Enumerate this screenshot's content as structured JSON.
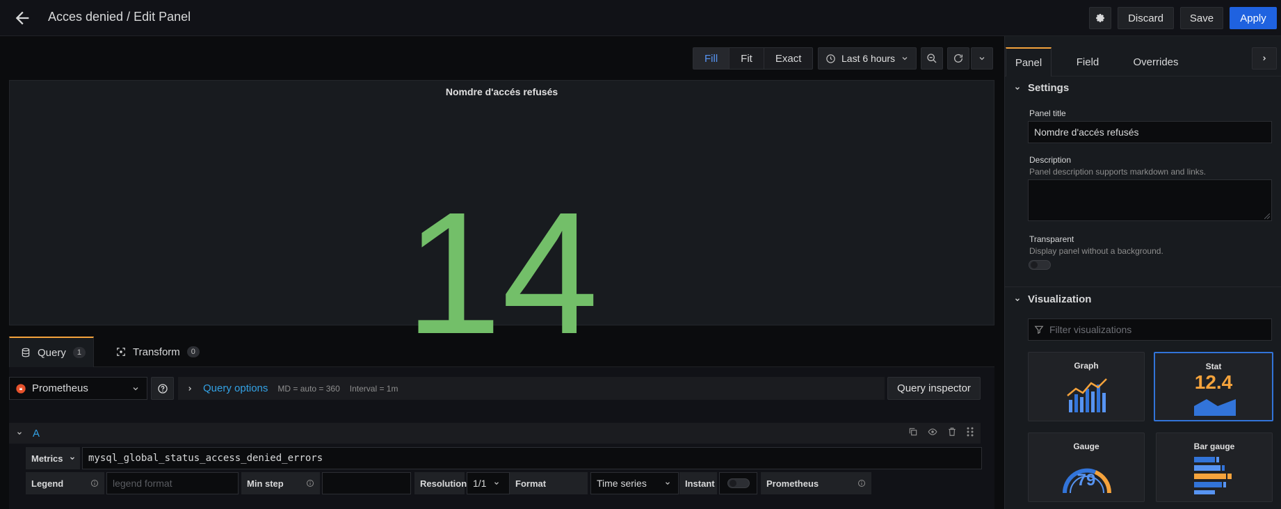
{
  "header": {
    "title": "Acces denied / Edit Panel",
    "discard_label": "Discard",
    "save_label": "Save",
    "apply_label": "Apply"
  },
  "toolbar": {
    "view_modes": [
      {
        "label": "Fill",
        "active": true
      },
      {
        "label": "Fit",
        "active": false
      },
      {
        "label": "Exact",
        "active": false
      }
    ],
    "time_range": "Last 6 hours"
  },
  "panel": {
    "title": "Nomdre d'accés refusés",
    "value": "14",
    "value_color": "#73bf69"
  },
  "query_tabs": [
    {
      "label": "Query",
      "count": "1"
    },
    {
      "label": "Transform",
      "count": "0"
    }
  ],
  "query": {
    "datasource": "Prometheus",
    "options_label": "Query options",
    "md": "MD = auto = 360",
    "interval": "Interval = 1m",
    "inspector_label": "Query inspector",
    "ref_id": "A",
    "metrics_label": "Metrics",
    "expr": "mysql_global_status_access_denied_errors",
    "legend_label": "Legend",
    "legend_placeholder": "legend format",
    "min_step_label": "Min step",
    "resolution_label": "Resolution",
    "resolution_value": "1/1",
    "format_label": "Format",
    "format_value": "Time series",
    "instant_label": "Instant",
    "instant_on": false,
    "source_label": "Prometheus"
  },
  "sidebar": {
    "tabs": [
      {
        "label": "Panel",
        "active": true
      },
      {
        "label": "Field",
        "active": false
      },
      {
        "label": "Overrides",
        "active": false
      }
    ],
    "settings": {
      "section_label": "Settings",
      "panel_title_label": "Panel title",
      "panel_title_value": "Nomdre d'accés refusés",
      "description_label": "Description",
      "description_help": "Panel description supports markdown and links.",
      "transparent_label": "Transparent",
      "transparent_help": "Display panel without a background.",
      "transparent_on": false
    },
    "visualization": {
      "section_label": "Visualization",
      "filter_placeholder": "Filter visualizations",
      "cards": [
        {
          "name": "Graph",
          "selected": false
        },
        {
          "name": "Stat",
          "selected": true,
          "sample": "12.4"
        },
        {
          "name": "Gauge",
          "selected": false,
          "sample": "79"
        },
        {
          "name": "Bar gauge",
          "selected": false
        }
      ]
    }
  },
  "colors": {
    "accent": "#1f62e0",
    "link": "#33a2e5",
    "tab_active": "#f5a33c",
    "stat_green": "#73bf69"
  }
}
